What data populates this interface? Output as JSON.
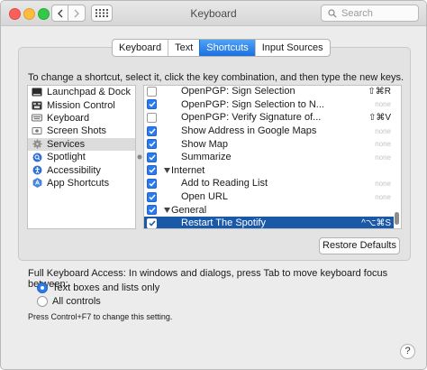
{
  "window": {
    "title": "Keyboard"
  },
  "search": {
    "placeholder": "Search"
  },
  "tabs": [
    {
      "label": "Keyboard",
      "active": false
    },
    {
      "label": "Text",
      "active": false
    },
    {
      "label": "Shortcuts",
      "active": true
    },
    {
      "label": "Input Sources",
      "active": false
    }
  ],
  "instructions": "To change a shortcut, select it, click the key combination, and then type the new keys.",
  "categories": [
    {
      "label": "Launchpad & Dock",
      "icon": "launchpad-dock-icon"
    },
    {
      "label": "Mission Control",
      "icon": "mission-control-icon"
    },
    {
      "label": "Keyboard",
      "icon": "keyboard-icon"
    },
    {
      "label": "Screen Shots",
      "icon": "screenshot-icon"
    },
    {
      "label": "Services",
      "icon": "services-gear-icon",
      "selected": true
    },
    {
      "label": "Spotlight",
      "icon": "spotlight-icon"
    },
    {
      "label": "Accessibility",
      "icon": "accessibility-icon"
    },
    {
      "label": "App Shortcuts",
      "icon": "app-shortcuts-icon"
    }
  ],
  "shortcuts": [
    {
      "label": "OpenPGP: Sign Selection",
      "checked": false,
      "key": "⇧⌘R",
      "indent": 2
    },
    {
      "label": "OpenPGP: Sign Selection to N...",
      "checked": true,
      "key": "none",
      "indent": 2
    },
    {
      "label": "OpenPGP: Verify Signature of...",
      "checked": false,
      "key": "⇧⌘V",
      "indent": 2
    },
    {
      "label": "Show Address in Google Maps",
      "checked": true,
      "key": "none",
      "indent": 2
    },
    {
      "label": "Show Map",
      "checked": true,
      "key": "none",
      "indent": 2
    },
    {
      "label": "Summarize",
      "checked": true,
      "key": "none",
      "indent": 2
    },
    {
      "label": "Internet",
      "checked": true,
      "key": "",
      "indent": 1,
      "group": true
    },
    {
      "label": "Add to Reading List",
      "checked": true,
      "key": "none",
      "indent": 2
    },
    {
      "label": "Open URL",
      "checked": true,
      "key": "none",
      "indent": 2
    },
    {
      "label": "General",
      "checked": true,
      "key": "",
      "indent": 1,
      "group": true
    },
    {
      "label": "Restart The Spotify",
      "checked": true,
      "key": "^⌥⌘S",
      "indent": 2,
      "selected": true
    }
  ],
  "buttons": {
    "restore_defaults": "Restore Defaults",
    "help": "?"
  },
  "full_keyboard_access": {
    "label": "Full Keyboard Access: In windows and dialogs, press Tab to move keyboard focus between:",
    "options": [
      {
        "label": "Text boxes and lists only",
        "selected": true
      },
      {
        "label": "All controls",
        "selected": false
      }
    ],
    "hint": "Press Control+F7 to change this setting."
  },
  "colors": {
    "accent": "#2b7bf0",
    "selection": "#1a58a8"
  }
}
